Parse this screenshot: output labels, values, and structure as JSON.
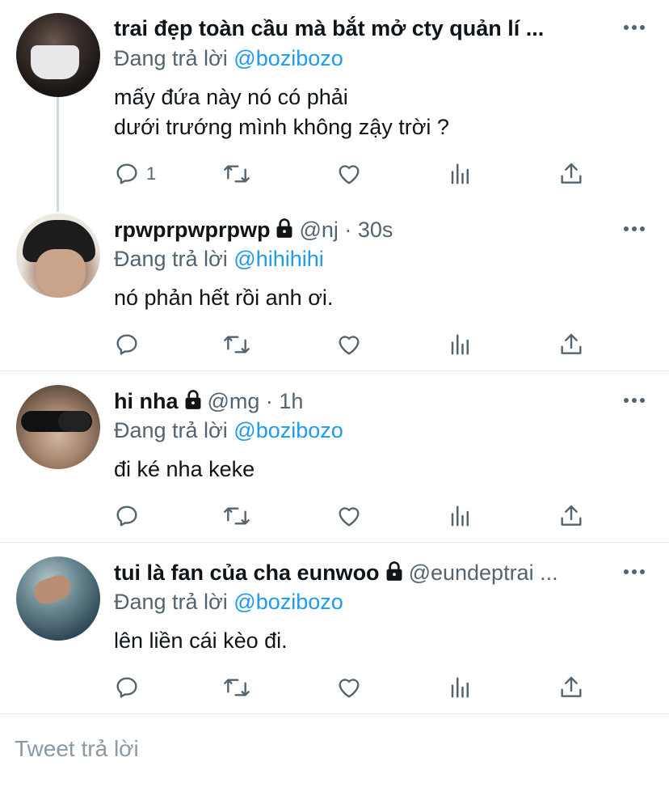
{
  "tweets": [
    {
      "name": "trai đẹp toàn cầu mà bắt mở cty quản lí ...",
      "handle": "",
      "time": "",
      "locked": false,
      "replying_label": "Đang trả lời",
      "replying_to": "@bozibozo",
      "text": "mấy đứa này nó có phải\ndưới trướng mình không zậy trời ?",
      "reply_count": "1"
    },
    {
      "name": "rpwprpwprpwp",
      "handle": "@nj · 30s",
      "locked": true,
      "replying_label": "Đang trả lời",
      "replying_to": "@hihihihi",
      "text": "nó phản hết rồi anh ơi.",
      "reply_count": ""
    },
    {
      "name": "hi nha",
      "handle": "@mg · 1h",
      "locked": true,
      "replying_label": "Đang trả lời",
      "replying_to": "@bozibozo",
      "text": "đi ké nha keke",
      "reply_count": ""
    },
    {
      "name": "tui là fan của cha eunwoo",
      "handle": "@eundeptrai ...",
      "locked": true,
      "replying_label": "Đang trả lời",
      "replying_to": "@bozibozo",
      "text": "lên liền cái kèo đi.",
      "reply_count": ""
    }
  ],
  "icons": [
    "reply-icon",
    "retweet-icon",
    "like-icon",
    "analytics-icon",
    "share-icon",
    "more-icon",
    "lock-icon"
  ],
  "colors": {
    "link": "#1d9bf0",
    "secondary": "#536471",
    "text": "#0f1419"
  },
  "composer": {
    "placeholder": "Tweet trả lời"
  }
}
